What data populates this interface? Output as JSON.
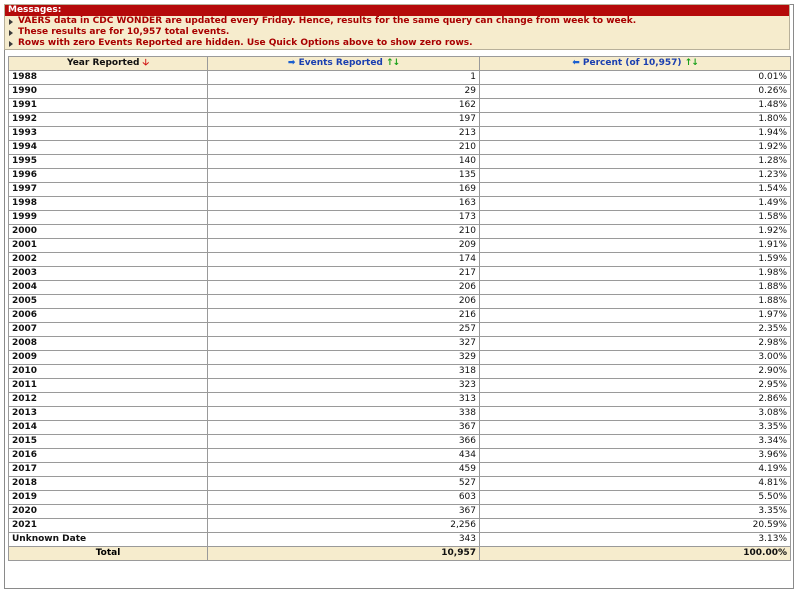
{
  "messages": {
    "header": "Messages:",
    "lines": [
      "VAERS data in CDC WONDER are updated every Friday. Hence, results for the same query can change from week to week.",
      "These results are for 10,957 total events.",
      "Rows with zero Events Reported are hidden. Use Quick Options above to show zero rows."
    ]
  },
  "table": {
    "headers": {
      "year": "Year Reported",
      "events": "Events Reported",
      "percent": "Percent (of 10,957)"
    },
    "icons": {
      "year_sort": "sort-down-red-arrow",
      "events_move": "move-right-blue-arrow",
      "percent_move": "move-left-blue-arrow",
      "sort_toggle": "sort-up-down-green-arrows"
    },
    "rows": [
      {
        "year": "1988",
        "events": "1",
        "percent": "0.01%"
      },
      {
        "year": "1990",
        "events": "29",
        "percent": "0.26%"
      },
      {
        "year": "1991",
        "events": "162",
        "percent": "1.48%"
      },
      {
        "year": "1992",
        "events": "197",
        "percent": "1.80%"
      },
      {
        "year": "1993",
        "events": "213",
        "percent": "1.94%"
      },
      {
        "year": "1994",
        "events": "210",
        "percent": "1.92%"
      },
      {
        "year": "1995",
        "events": "140",
        "percent": "1.28%"
      },
      {
        "year": "1996",
        "events": "135",
        "percent": "1.23%"
      },
      {
        "year": "1997",
        "events": "169",
        "percent": "1.54%"
      },
      {
        "year": "1998",
        "events": "163",
        "percent": "1.49%"
      },
      {
        "year": "1999",
        "events": "173",
        "percent": "1.58%"
      },
      {
        "year": "2000",
        "events": "210",
        "percent": "1.92%"
      },
      {
        "year": "2001",
        "events": "209",
        "percent": "1.91%"
      },
      {
        "year": "2002",
        "events": "174",
        "percent": "1.59%"
      },
      {
        "year": "2003",
        "events": "217",
        "percent": "1.98%"
      },
      {
        "year": "2004",
        "events": "206",
        "percent": "1.88%"
      },
      {
        "year": "2005",
        "events": "206",
        "percent": "1.88%"
      },
      {
        "year": "2006",
        "events": "216",
        "percent": "1.97%"
      },
      {
        "year": "2007",
        "events": "257",
        "percent": "2.35%"
      },
      {
        "year": "2008",
        "events": "327",
        "percent": "2.98%"
      },
      {
        "year": "2009",
        "events": "329",
        "percent": "3.00%"
      },
      {
        "year": "2010",
        "events": "318",
        "percent": "2.90%"
      },
      {
        "year": "2011",
        "events": "323",
        "percent": "2.95%"
      },
      {
        "year": "2012",
        "events": "313",
        "percent": "2.86%"
      },
      {
        "year": "2013",
        "events": "338",
        "percent": "3.08%"
      },
      {
        "year": "2014",
        "events": "367",
        "percent": "3.35%"
      },
      {
        "year": "2015",
        "events": "366",
        "percent": "3.34%"
      },
      {
        "year": "2016",
        "events": "434",
        "percent": "3.96%"
      },
      {
        "year": "2017",
        "events": "459",
        "percent": "4.19%"
      },
      {
        "year": "2018",
        "events": "527",
        "percent": "4.81%"
      },
      {
        "year": "2019",
        "events": "603",
        "percent": "5.50%"
      },
      {
        "year": "2020",
        "events": "367",
        "percent": "3.35%"
      },
      {
        "year": "2021",
        "events": "2,256",
        "percent": "20.59%"
      },
      {
        "year": "Unknown Date",
        "events": "343",
        "percent": "3.13%"
      }
    ],
    "total": {
      "label": "Total",
      "events": "10,957",
      "percent": "100.00%"
    }
  },
  "colors": {
    "message_header_bg": "#b50a0a",
    "message_text": "#a80000",
    "header_bg": "#f6eccd",
    "link_blue": "#1a3fb0",
    "sort_red": "#d01010",
    "sort_green": "#1aa01a"
  }
}
